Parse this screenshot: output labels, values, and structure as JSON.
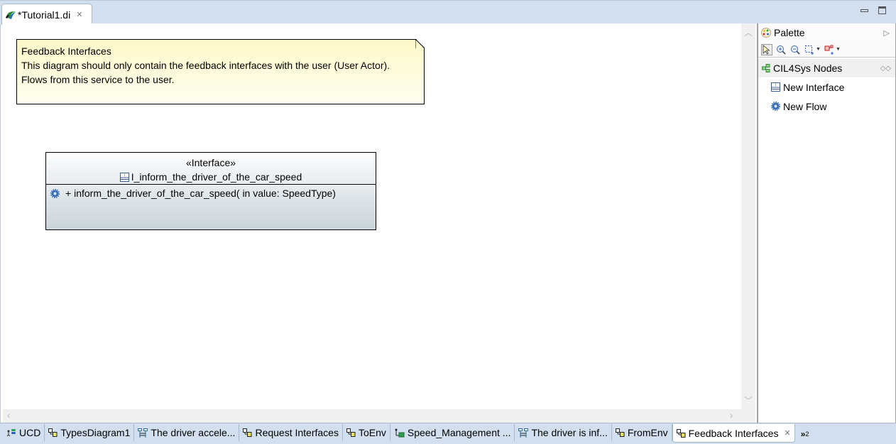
{
  "editor_tab": {
    "title": "*Tutorial1.di",
    "close_icon": "close-icon"
  },
  "window_controls": {
    "minimize": "minimize-icon",
    "maximize": "maximize-icon"
  },
  "note": {
    "lines": [
      "Feedback Interfaces",
      "This diagram should only contain the feedback interfaces with the user (User Actor).",
      "Flows from this service to the user."
    ]
  },
  "interface": {
    "stereotype": "«Interface»",
    "name": "I_inform_the_driver_of_the_car_speed",
    "operations": [
      {
        "visibility": "+",
        "signature": "inform_the_driver_of_the_car_speed(  in value: SpeedType)"
      }
    ]
  },
  "palette": {
    "title": "Palette",
    "tools": [
      "select-tool",
      "zoom-in-tool",
      "zoom-out-tool",
      "marquee-tool",
      "connection-select-tool"
    ],
    "drawer": {
      "title": "CIL4Sys Nodes"
    },
    "items": [
      {
        "label": "New Interface",
        "icon": "interface-icon"
      },
      {
        "label": "New Flow",
        "icon": "gear-icon"
      }
    ]
  },
  "bottom_tabs": [
    {
      "label": "UCD",
      "icon": "use-case-diagram-icon",
      "active": false
    },
    {
      "label": "TypesDiagram1",
      "icon": "class-diagram-icon",
      "active": false
    },
    {
      "label": "The driver accele...",
      "icon": "sequence-diagram-icon",
      "active": false
    },
    {
      "label": "Request Interfaces",
      "icon": "class-diagram-icon",
      "active": false
    },
    {
      "label": "ToEnv",
      "icon": "class-diagram-icon",
      "active": false
    },
    {
      "label": "Speed_Management ...",
      "icon": "composite-diagram-icon",
      "active": false
    },
    {
      "label": "The driver is inf...",
      "icon": "sequence-diagram-icon",
      "active": false
    },
    {
      "label": "FromEnv",
      "icon": "class-diagram-icon",
      "active": false
    },
    {
      "label": "Feedback Interfaces",
      "icon": "class-diagram-icon",
      "active": true
    }
  ],
  "more_tabs": {
    "label": "»",
    "count": "2"
  }
}
